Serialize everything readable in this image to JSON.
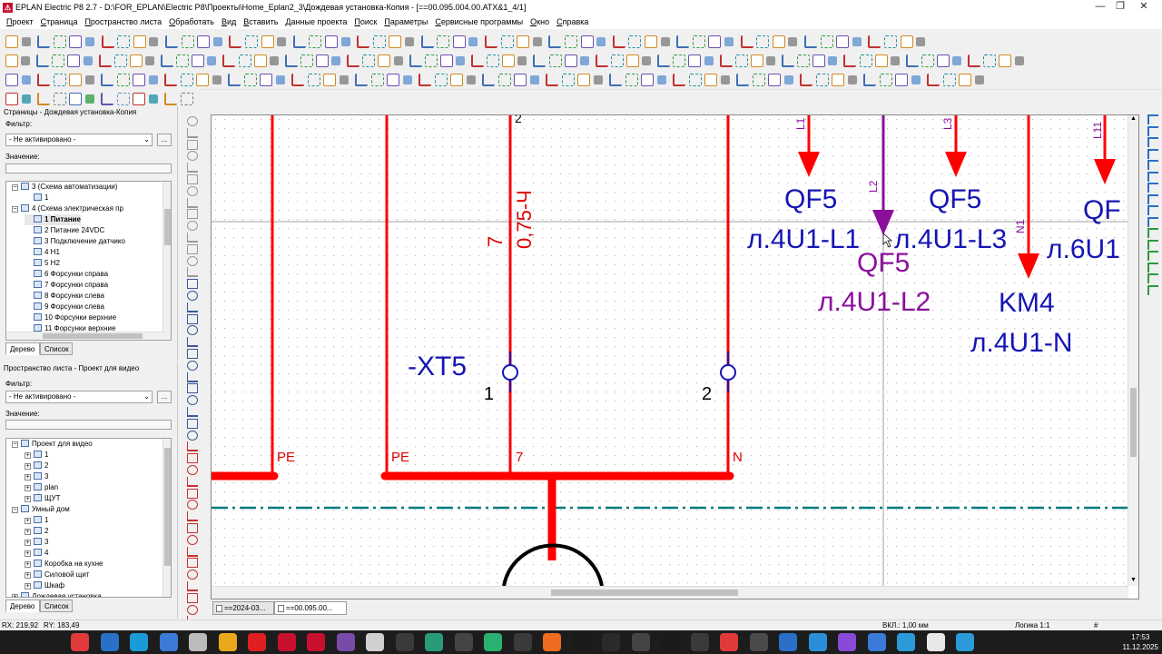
{
  "window": {
    "title": "EPLAN Electric P8 2.7 - D:\\FOR_EPLAN\\Electric P8\\Проекты\\Home_Eplan2_3\\Дождевая установка-Копия - [==00.095.004.00.ATX&1_4/1]",
    "minimize": "—",
    "restore": "❐",
    "close": "✕"
  },
  "menu": [
    "Проект",
    "Страница",
    "Пространство листа",
    "Обработать",
    "Вид",
    "Вставить",
    "Данные проекта",
    "Поиск",
    "Параметры",
    "Сервисные программы",
    "Окно",
    "Справка"
  ],
  "pages_panel": {
    "title": "Страницы - Дождевая установка-Копия",
    "filter_label": "Фильтр:",
    "filter_value": "- Не активировано -",
    "dots": "...",
    "value_label": "Значение:",
    "nodes": [
      {
        "text": "3 (Схема автоматизации)",
        "indent": 0,
        "pm": "−",
        "bold": false
      },
      {
        "text": "1",
        "indent": 1,
        "pm": "",
        "bold": false
      },
      {
        "text": "4 (Схема электрическая  пр",
        "indent": 0,
        "pm": "−",
        "bold": false
      },
      {
        "text": "1 Питание",
        "indent": 1,
        "pm": "",
        "bold": true
      },
      {
        "text": "2 Питание 24VDC",
        "indent": 1,
        "pm": "",
        "bold": false
      },
      {
        "text": "3 Подключение датчико",
        "indent": 1,
        "pm": "",
        "bold": false
      },
      {
        "text": "4 H1",
        "indent": 1,
        "pm": "",
        "bold": false
      },
      {
        "text": "5 H2",
        "indent": 1,
        "pm": "",
        "bold": false
      },
      {
        "text": "6 Форсунки справа",
        "indent": 1,
        "pm": "",
        "bold": false
      },
      {
        "text": "7 Форсунки справа",
        "indent": 1,
        "pm": "",
        "bold": false
      },
      {
        "text": "8 Форсунки слева",
        "indent": 1,
        "pm": "",
        "bold": false
      },
      {
        "text": "9 Форсунки слева",
        "indent": 1,
        "pm": "",
        "bold": false
      },
      {
        "text": "10 Форсунки верхние",
        "indent": 1,
        "pm": "",
        "bold": false
      },
      {
        "text": "11 Форсунки верхние",
        "indent": 1,
        "pm": "",
        "bold": false
      }
    ],
    "tab_tree": "Дерево",
    "tab_list": "Список"
  },
  "layout_panel": {
    "title": "Пространство листа - Проект для видео",
    "filter_label": "Фильтр:",
    "filter_value": "- Не активировано -",
    "dots": "...",
    "value_label": "Значение:",
    "nodes": [
      {
        "text": "Проект для видео",
        "indent": 0,
        "pm": "−"
      },
      {
        "text": "1",
        "indent": 1,
        "pm": "+"
      },
      {
        "text": "2",
        "indent": 1,
        "pm": "+"
      },
      {
        "text": "3",
        "indent": 1,
        "pm": "+"
      },
      {
        "text": "plan",
        "indent": 1,
        "pm": "+"
      },
      {
        "text": "ЩУТ",
        "indent": 1,
        "pm": "+"
      },
      {
        "text": "Умный дом",
        "indent": 0,
        "pm": "−"
      },
      {
        "text": "1",
        "indent": 1,
        "pm": "+"
      },
      {
        "text": "2",
        "indent": 1,
        "pm": "+"
      },
      {
        "text": "3",
        "indent": 1,
        "pm": "+"
      },
      {
        "text": "4",
        "indent": 1,
        "pm": "+"
      },
      {
        "text": "Коробка на кухне",
        "indent": 1,
        "pm": "+"
      },
      {
        "text": "Силовой щит",
        "indent": 1,
        "pm": "+"
      },
      {
        "text": "Шкаф",
        "indent": 1,
        "pm": "+"
      },
      {
        "text": "Дождевая установка",
        "indent": 0,
        "pm": "+"
      }
    ],
    "tab_tree": "Дерево",
    "tab_list": "Список"
  },
  "schematic": {
    "top_wire_number": "2",
    "wire_label_number": "7",
    "wire_label_cross": "0,75-Ч",
    "terminal_name": "-XT5",
    "terminal_1": "1",
    "terminal_2": "2",
    "bus_label_pe1": "PE",
    "bus_label_pe2": "PE",
    "bus_label_7": "7",
    "bus_label_n": "N",
    "ref1_phase": "L1",
    "ref1_device": "QF5",
    "ref1_target": "л.4U1-L1",
    "ref2_phase": "L2",
    "ref2_device": "QF5",
    "ref2_target": "л.4U1-L2",
    "ref3_phase": "L3",
    "ref3_device": "QF5",
    "ref3_target": "л.4U1-L3",
    "ref4_phase": "N1",
    "ref4_device": "KM4",
    "ref4_target": "л.4U1-N",
    "ref5_phase": "L11",
    "ref5_device": "QF",
    "ref5_target": "л.6U1",
    "colors": {
      "wire": "#ff0000",
      "reference": "#1515b4",
      "highlight": "#8b0f9c",
      "dashdot": "#007b7b"
    }
  },
  "page_tabs": [
    "==2024-03...",
    "==00.095.00..."
  ],
  "status": {
    "rx": "RX: 219,92",
    "ry": "RY: 183,49",
    "grid": "ВКЛ.: 1,00 мм",
    "logic": "Логика 1:1",
    "hash": "#"
  },
  "clock": {
    "time": "17:53",
    "date": "11.12.2025"
  }
}
